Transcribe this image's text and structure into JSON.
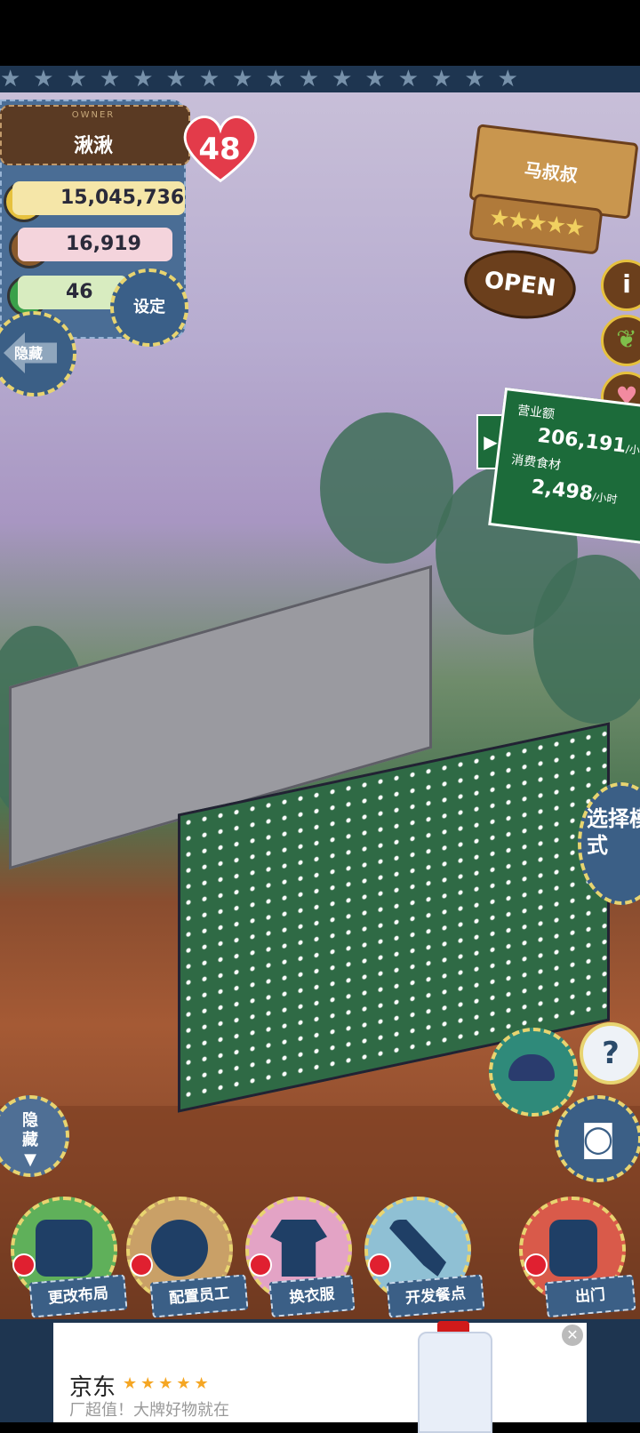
{
  "owner_panel": {
    "owner_label": "OWNER",
    "name": "湫湫",
    "level": "48",
    "money": "15,045,736",
    "food": "16,919",
    "clover": "46",
    "settings_label": "设定",
    "hide_label": "隐藏"
  },
  "shop_sign": {
    "title": "马叔叔",
    "rating_stars": 5,
    "open_label": "OPEN"
  },
  "side_icons": [
    "i-icon",
    "leaf-icon",
    "heart-icon"
  ],
  "revenue_board": {
    "revenue_label": "营业额",
    "revenue_value": "206,191",
    "revenue_unit": "/小时",
    "consume_label": "消费食材",
    "consume_value": "2,498",
    "consume_unit": "/小时"
  },
  "mode_button": {
    "label": "选择模式"
  },
  "hide_down_label": "隐藏",
  "bottom_actions": [
    {
      "label": "更改布局",
      "icon": "table-icon",
      "color": "#5fb05a"
    },
    {
      "label": "配置员工",
      "icon": "mouse-icon",
      "color": "#c9a067"
    },
    {
      "label": "换衣服",
      "icon": "shirt-icon",
      "color": "#e3a3c5"
    },
    {
      "label": "开发餐点",
      "icon": "knife-icon",
      "color": "#8fc0d4"
    },
    {
      "label": "出门",
      "icon": "door-icon",
      "color": "#d95a4a"
    }
  ],
  "ad": {
    "brand": "京东",
    "stars": "★★★★★",
    "subtitle": "厂超值！大牌好物就在"
  }
}
